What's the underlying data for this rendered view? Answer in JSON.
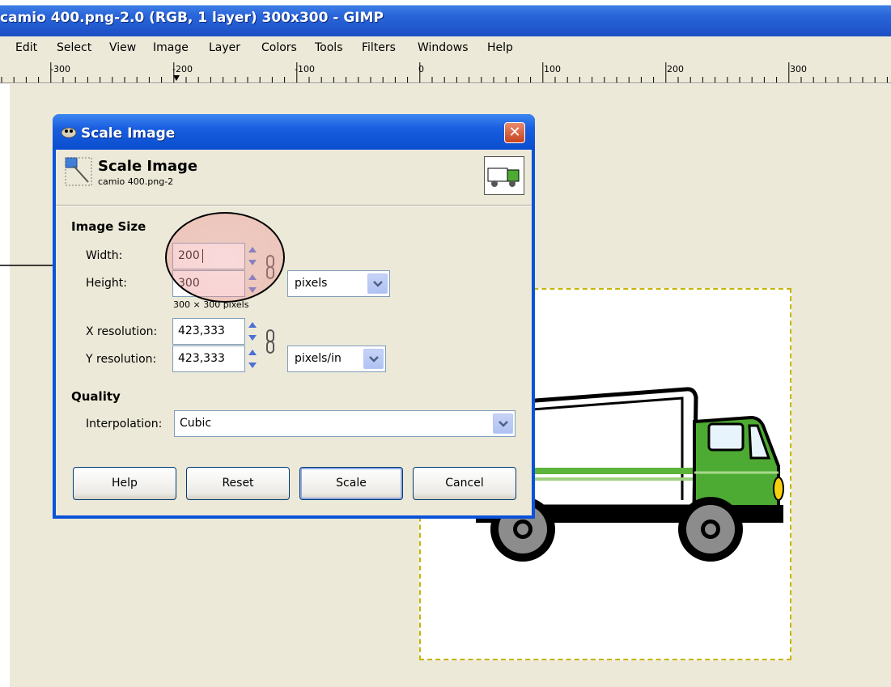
{
  "window": {
    "title": "camio 400.png-2.0 (RGB, 1 layer) 300x300 - GIMP"
  },
  "menubar": {
    "items": [
      "Edit",
      "Select",
      "View",
      "Image",
      "Layer",
      "Colors",
      "Tools",
      "Filters",
      "Windows",
      "Help"
    ]
  },
  "ruler": {
    "labels": [
      "-300",
      "-200",
      "-100",
      "0",
      "100",
      "200",
      "300"
    ]
  },
  "dialog": {
    "window_title": "Scale Image",
    "header_title": "Scale Image",
    "header_subtitle": "camio 400.png-2",
    "image_size_section": "Image Size",
    "width_label": "Width:",
    "width_value": "200",
    "height_label": "Height:",
    "height_value": "300",
    "size_unit": "pixels",
    "size_note": "300 × 300 pixels",
    "xres_label": "X resolution:",
    "xres_value": "423,333",
    "yres_label": "Y resolution:",
    "yres_value": "423,333",
    "res_unit": "pixels/in",
    "quality_section": "Quality",
    "interpolation_label": "Interpolation:",
    "interpolation_value": "Cubic",
    "buttons": {
      "help": "Help",
      "reset": "Reset",
      "scale": "Scale",
      "cancel": "Cancel"
    }
  },
  "icons": {
    "close": "close-icon",
    "gimp": "gimp-icon",
    "scale": "scale-image-icon",
    "chain": "chain-link-icon",
    "dropdown": "chevron-down-icon"
  },
  "colors": {
    "title_bar": "#2a67db",
    "dialog_bg": "#ece9d8",
    "truck_green": "#4daa32"
  }
}
